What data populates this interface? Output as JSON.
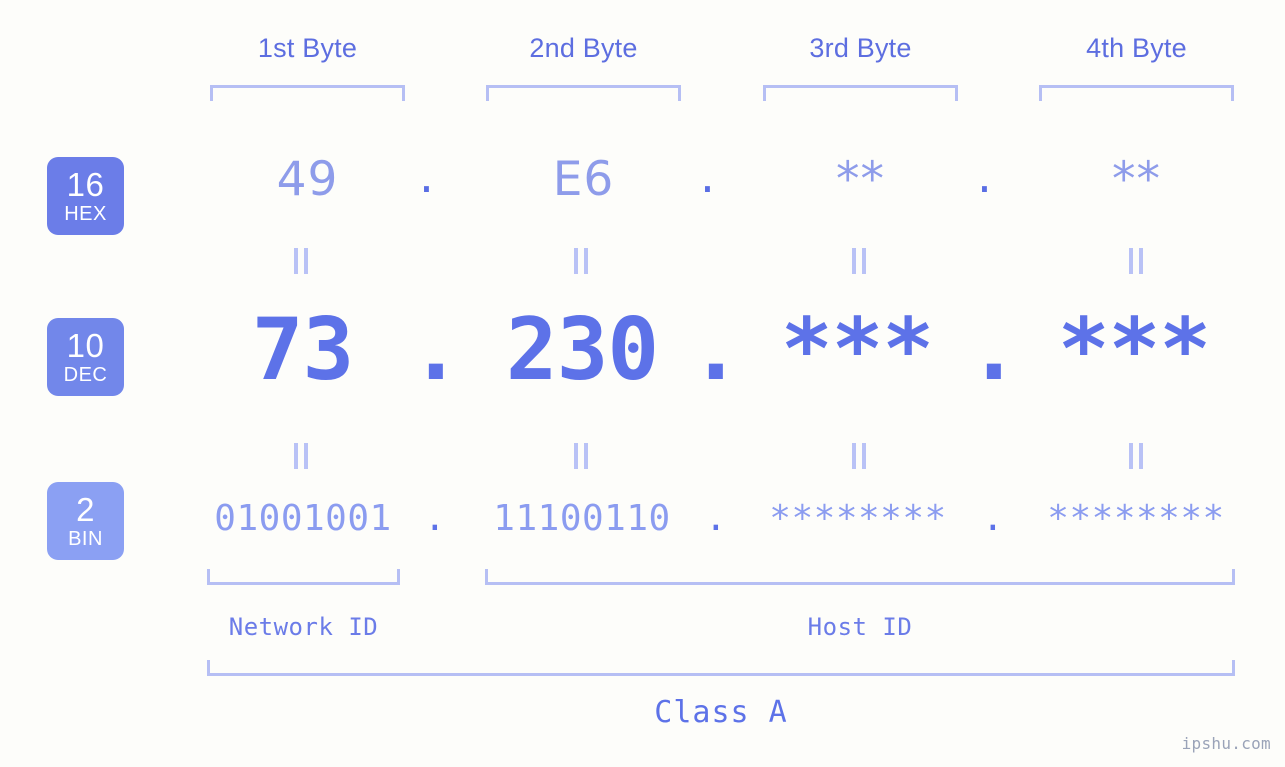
{
  "background_color": "#fdfdfa",
  "accent_color": "#5d72e8",
  "bracket_color": "#b6bff4",
  "byte_headers": [
    {
      "label": "1st Byte"
    },
    {
      "label": "2nd Byte"
    },
    {
      "label": "3rd Byte"
    },
    {
      "label": "4th Byte"
    }
  ],
  "rows": [
    {
      "base": "16",
      "base_name": "HEX",
      "badge_color": "#6b7de8",
      "values": [
        "49",
        "E6",
        "**",
        "**"
      ],
      "separators": [
        ".",
        ".",
        "."
      ]
    },
    {
      "base": "10",
      "base_name": "DEC",
      "badge_color": "#7287ea",
      "values": [
        "73",
        "230",
        "***",
        "***"
      ],
      "separators": [
        ".",
        ".",
        "."
      ]
    },
    {
      "base": "2",
      "base_name": "BIN",
      "badge_color": "#8ba0f3",
      "values": [
        "01001001",
        "11100110",
        "********",
        "********"
      ],
      "separators": [
        ".",
        ".",
        "."
      ]
    }
  ],
  "equality_symbol": "=",
  "sections": [
    {
      "label": "Network ID"
    },
    {
      "label": "Host ID"
    }
  ],
  "class": {
    "label": "Class A"
  },
  "watermark": {
    "text": "ipshu.com"
  }
}
